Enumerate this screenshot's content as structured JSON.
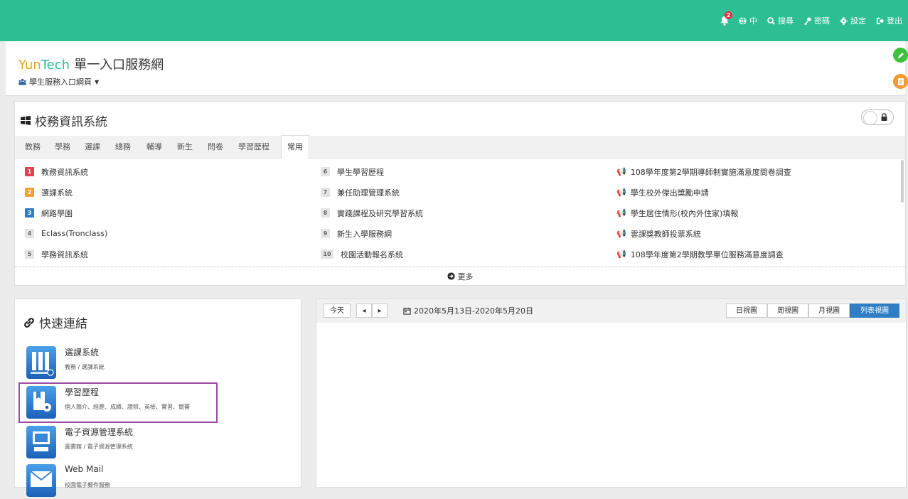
{
  "topbar": {
    "notification_count": "2",
    "lang_label": "中",
    "search_label": "搜尋",
    "password_label": "密碼",
    "settings_label": "設定",
    "logout_label": "登出"
  },
  "header": {
    "brand_part1": "Yun",
    "brand_part2": "Tech",
    "brand_part3": "單一入口服務網",
    "portal_label": "學生服務入口網頁"
  },
  "system_panel": {
    "title": "校務資訊系統",
    "tabs": [
      "教務",
      "學務",
      "選課",
      "總務",
      "輔導",
      "新生",
      "問卷",
      "學習歷程",
      "常用"
    ],
    "active_tab": "常用",
    "col1": [
      {
        "num": "1",
        "label": "教務資訊系統"
      },
      {
        "num": "2",
        "label": "選課系統"
      },
      {
        "num": "3",
        "label": "網路學園"
      },
      {
        "num": "4",
        "label": "Eclass(Tronclass)"
      },
      {
        "num": "5",
        "label": "學務資訊系統"
      }
    ],
    "col2": [
      {
        "num": "6",
        "label": "學生學習歷程"
      },
      {
        "num": "7",
        "label": "兼任助理管理系統"
      },
      {
        "num": "8",
        "label": "實踐課程及研究學習系統"
      },
      {
        "num": "9",
        "label": "新生入學服務網"
      },
      {
        "num": "10",
        "label": "校園活動報名系統"
      }
    ],
    "announcements": [
      "108學年度第2學期導師制實施滿意度問卷調查",
      "學生校外傑出獎勵申請",
      "學生居住情形(校內外住家)填報",
      "雲課獎教師投票系統",
      "108學年度第2學期教學單位服務滿意度調查"
    ],
    "more_label": "更多"
  },
  "quick_links": {
    "title": "快速連結",
    "items": [
      {
        "title": "選課系統",
        "subtitle": "教務 / 選課系統"
      },
      {
        "title": "學習歷程",
        "subtitle": "個人簡介、經歷、成績、證照、英檢、實習、競賽"
      },
      {
        "title": "電子資源管理系統",
        "subtitle": "圖書館 / 電子資源管理系統"
      },
      {
        "title": "Web Mail",
        "subtitle": "校園電子郵件服務"
      }
    ]
  },
  "calendar": {
    "today_label": "今天",
    "range": "2020年5月13日-2020年5月20日",
    "views": [
      "日視圖",
      "周視圖",
      "月視圖",
      "列表視圖"
    ],
    "active_view": "列表視圖"
  },
  "colors": {
    "topbar": "#2dbf93",
    "brand_yun": "#f2a122",
    "brand_tech": "#2dbf93",
    "highlight": "#9b4ba6",
    "active_view": "#2f7ec3"
  }
}
